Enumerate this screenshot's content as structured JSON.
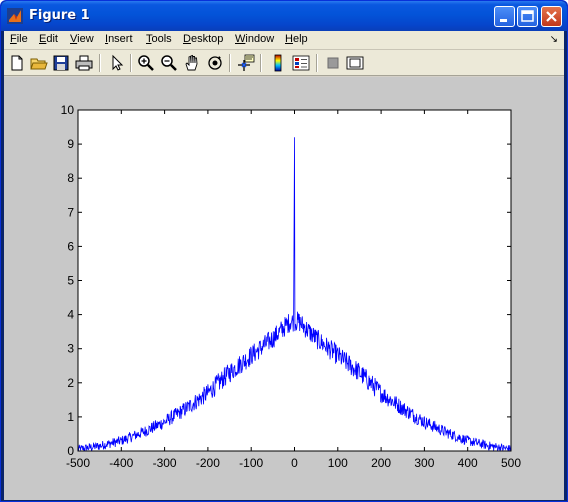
{
  "window": {
    "title": "Figure 1"
  },
  "title_buttons": [
    "minimize",
    "maximize",
    "close"
  ],
  "menubar": {
    "items": [
      "File",
      "Edit",
      "View",
      "Insert",
      "Tools",
      "Desktop",
      "Window",
      "Help"
    ]
  },
  "toolbar": {
    "tools": [
      "new-figure-icon",
      "open-file-icon",
      "save-icon",
      "print-icon",
      "pointer-icon",
      "zoom-in-icon",
      "zoom-out-icon",
      "pan-hand-icon",
      "rotate-3d-icon",
      "data-cursor-icon",
      "colorbar-icon",
      "legend-icon",
      "hide-plot-tools-icon",
      "show-plot-tools-icon"
    ]
  },
  "colors": {
    "line": "#0000ff",
    "figure_bg": "#c8c8c8",
    "axes_bg": "#ffffff"
  },
  "chart_data": {
    "type": "line",
    "title": "",
    "xlabel": "",
    "ylabel": "",
    "xlim": [
      -500,
      500
    ],
    "ylim": [
      0,
      10
    ],
    "xticks": [
      -500,
      -400,
      -300,
      -200,
      -100,
      0,
      100,
      200,
      300,
      400,
      500
    ],
    "yticks": [
      0,
      1,
      2,
      3,
      4,
      5,
      6,
      7,
      8,
      9,
      10
    ],
    "grid": false,
    "legend": "none",
    "series": [
      {
        "x": [
          -500,
          -450,
          -400,
          -350,
          -300,
          -250,
          -200,
          -150,
          -100,
          -50,
          -10,
          0,
          10,
          50,
          100,
          150,
          200,
          250,
          300,
          350,
          400,
          450,
          500
        ],
        "y": [
          0.05,
          0.15,
          0.3,
          0.55,
          0.85,
          1.25,
          1.7,
          2.3,
          2.8,
          3.3,
          3.8,
          9.2,
          3.8,
          3.3,
          2.8,
          2.3,
          1.7,
          1.25,
          0.85,
          0.55,
          0.3,
          0.15,
          0.05
        ],
        "noise": 0.3,
        "peak": {
          "x": 0,
          "y": 9.2
        },
        "secondary_peak": {
          "x": -1,
          "y": 6.7
        }
      }
    ]
  }
}
